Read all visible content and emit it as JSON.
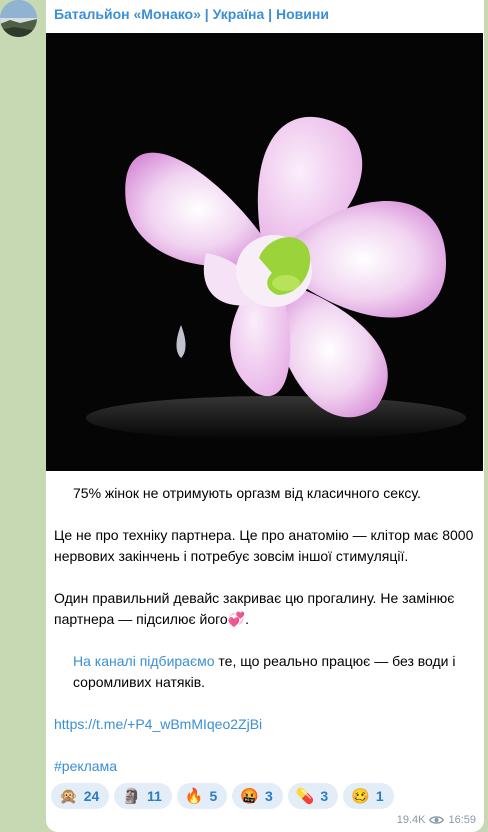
{
  "channel": {
    "name": "Батальйон «Монако» | Україна | Новини"
  },
  "post": {
    "line1": "75% жінок не отримують оргазм від класичного сексу.",
    "para2": "Це не про техніку партнера. Це про анатомію — клітор має 8000 нервових закінчень і потребує зовсім іншої стимуляції.",
    "para3": "Один правильний девайс закриває цю прогалину. Не замінює партнера — підсилює його💞.",
    "para4_link": "На каналі підбираємо",
    "para4_rest": " те, що реально працює — без води і соромливих натяків.",
    "url": "https://t.me/+P4_wBmMIqeo2ZjBi",
    "hashtag": "#реклама"
  },
  "reactions": [
    {
      "emoji": "🙊",
      "icon": "see-no-evil-monkey-icon",
      "count": "24"
    },
    {
      "emoji": "🗿",
      "icon": "moai-icon",
      "count": "11"
    },
    {
      "emoji": "🔥",
      "icon": "fire-icon",
      "count": "5"
    },
    {
      "emoji": "🤬",
      "icon": "cursing-face-icon",
      "count": "3"
    },
    {
      "emoji": "💊",
      "icon": "pill-icon",
      "count": "3"
    },
    {
      "emoji": "🥴",
      "icon": "woozy-face-icon",
      "count": "1"
    }
  ],
  "meta": {
    "views": "19.4K",
    "time": "16:59"
  },
  "colors": {
    "link": "#3a8fd6",
    "chat_bg": "#c7d9b2",
    "reaction_bg": "#e3edf7"
  }
}
